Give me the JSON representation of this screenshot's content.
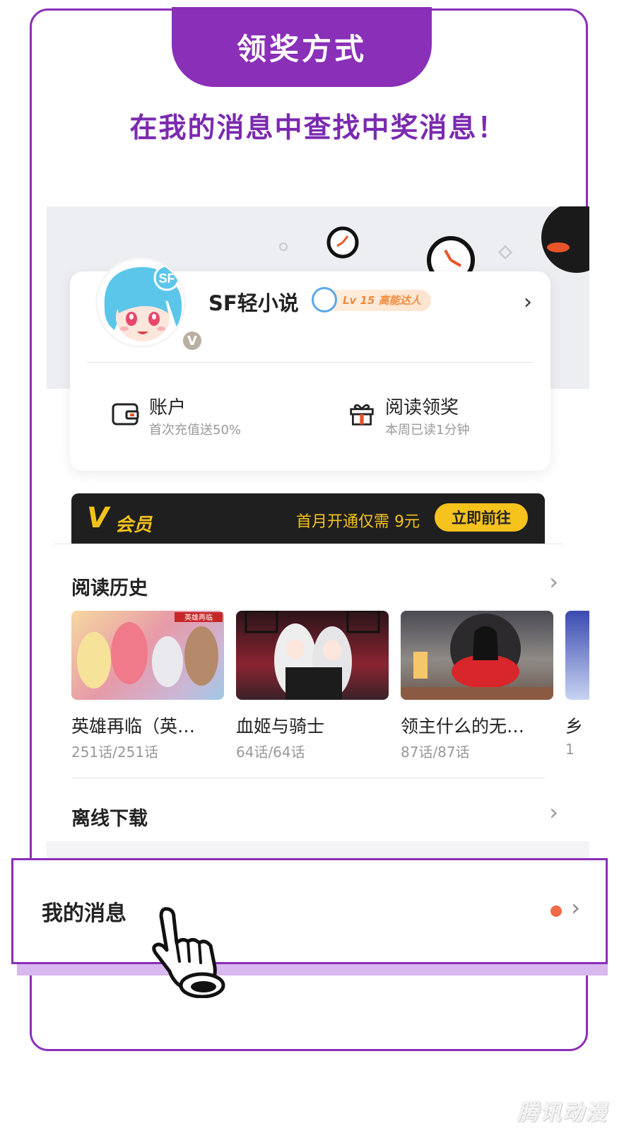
{
  "header": {
    "tab_title": "领奖方式",
    "subtitle": "在我的消息中查找中奖消息！"
  },
  "profile": {
    "username": "SF轻小说",
    "level_badge": "Lv 15 高能达人",
    "verified_badge": "V",
    "avatar_text": "SF",
    "account": {
      "label": "账户",
      "sub": "首次充值送50%",
      "icon": "wallet-icon"
    },
    "reading_reward": {
      "label": "阅读领奖",
      "sub": "本周已读1分钟",
      "icon": "gift-icon"
    }
  },
  "vip": {
    "logo": "V",
    "label": "会员",
    "offer": "首月开通仅需 9元",
    "button": "立即前往"
  },
  "reading_history": {
    "title": "阅读历史",
    "books": [
      {
        "name": "英雄再临（英…",
        "progress": "251话/251话",
        "cover_label": "英雄再临"
      },
      {
        "name": "血姬与骑士",
        "progress": "64话/64话"
      },
      {
        "name": "领主什么的无…",
        "progress": "87话/87话"
      },
      {
        "name": "乡",
        "progress": "1"
      }
    ]
  },
  "offline_download": {
    "title": "离线下载"
  },
  "messages": {
    "title": "我的消息",
    "has_unread": true
  },
  "watermark": "腾讯动漫",
  "colors": {
    "accent_purple": "#8a2fb8",
    "vip_gold": "#f3c21a",
    "unread_dot": "#f06b45"
  }
}
